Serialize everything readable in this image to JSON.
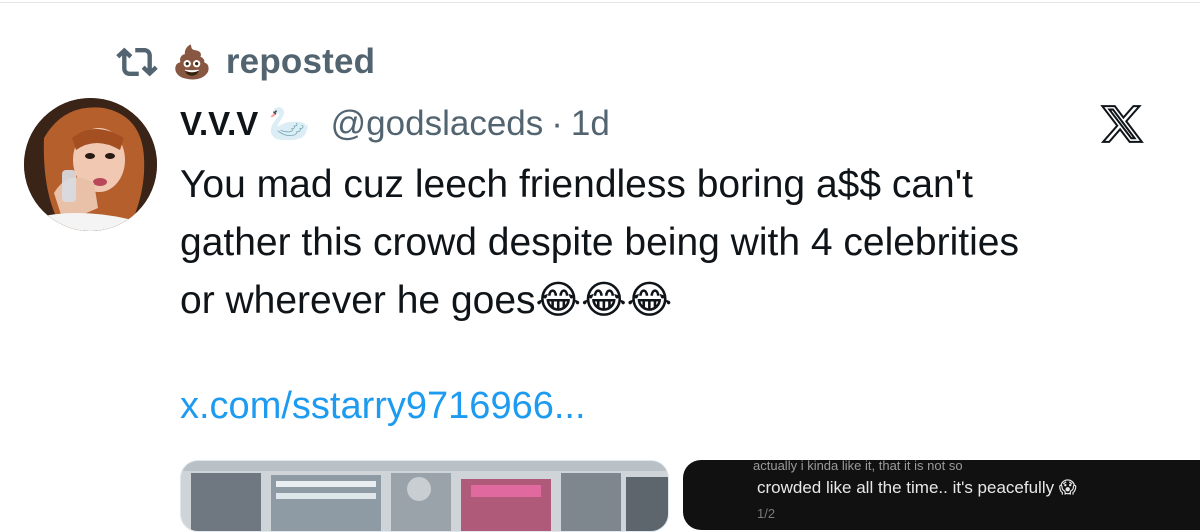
{
  "repost": {
    "icon": "repost-icon",
    "emoji": "💩",
    "label": "reposted"
  },
  "tweet": {
    "author": {
      "display_name": "V.V.V",
      "name_emoji": "🦢",
      "handle": "@godslaceds",
      "separator": "·",
      "time": "1d",
      "avatar": "avatar-photo"
    },
    "text_line1": "You mad cuz leech friendless boring a$$ can't",
    "text_line2": "gather this crowd despite being with 4 celebrities",
    "text_line3": "or wherever he goes",
    "text_emojis": "😂😂😂",
    "link": "x.com/sstarry9716966...",
    "media": {
      "left": "mall-photo",
      "right_top_text": "actually i kinda like it, that it is not so",
      "right_text": "crowded like all the time.. it's peacefully",
      "right_emoji": "😱",
      "right_bottom_text": "1/2"
    }
  },
  "brand": {
    "logo": "x-logo-icon",
    "colors": {
      "link": "#1d9bf0",
      "secondary_text": "#536471",
      "text": "#0f1419"
    }
  }
}
